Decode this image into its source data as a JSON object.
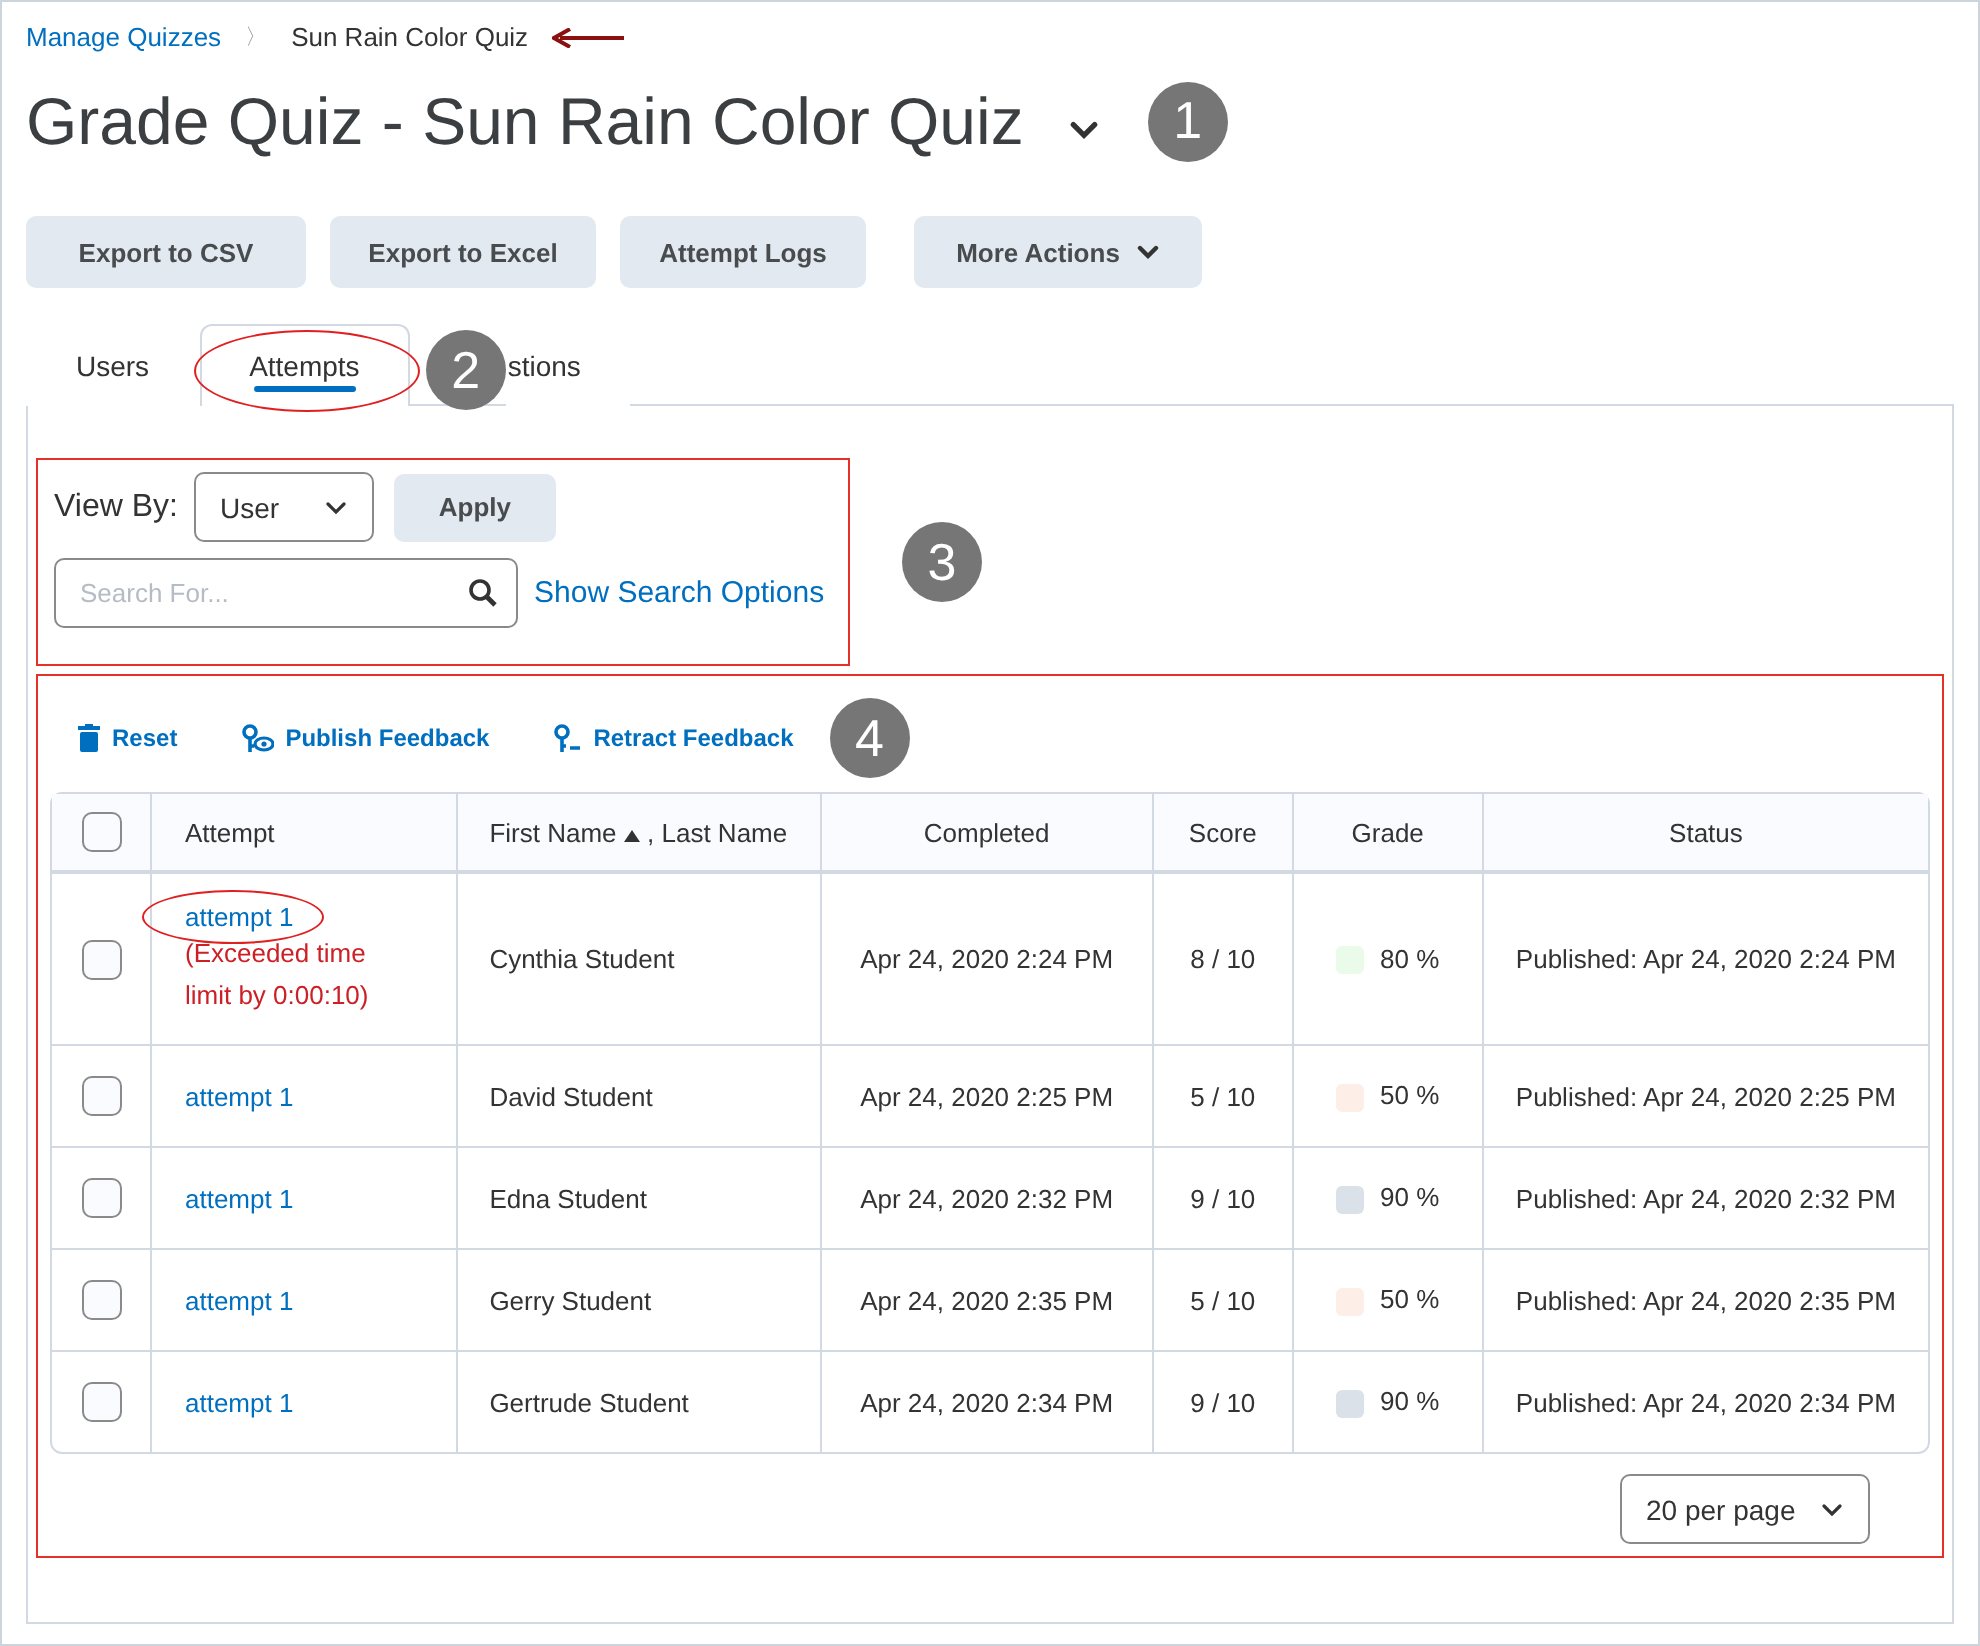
{
  "breadcrumb": {
    "link": "Manage Quizzes",
    "separator": "〉",
    "current": "Sun Rain Color Quiz",
    "arrow": true
  },
  "title": {
    "text": "Grade Quiz - Sun Rain Color Quiz",
    "callout": "1"
  },
  "actions": [
    {
      "label": "Export to CSV",
      "dropdown": false
    },
    {
      "label": "Export to Excel",
      "dropdown": false
    },
    {
      "label": "Attempt Logs",
      "dropdown": false
    },
    {
      "label": "More Actions",
      "dropdown": true
    }
  ],
  "tabs": [
    {
      "label": "Users",
      "selected": false,
      "circled": false
    },
    {
      "label": "Attempts",
      "selected": true,
      "circled": true
    },
    {
      "label": "stions",
      "selected": false,
      "circled": false
    }
  ],
  "tabs_callout": "2",
  "view_options": {
    "outlined": true,
    "callout": "3",
    "view_by_label": "View By:",
    "view_by_value": "User",
    "apply": "Apply",
    "search_placeholder": "Search For...",
    "search_options": "Show Search Options"
  },
  "results": {
    "outlined": true,
    "callout": "4",
    "toolbar": [
      {
        "kind": "trash",
        "label": "Reset"
      },
      {
        "kind": "publish",
        "label": "Publish Feedback"
      },
      {
        "kind": "retract",
        "label": "Retract Feedback"
      }
    ],
    "columns": [
      "Attempt",
      "First Name",
      ",",
      "Last Name",
      "Completed",
      "Score",
      "Grade",
      "Status"
    ],
    "header_checked": false,
    "rows": [
      {
        "checked": false,
        "attempt": "attempt 1",
        "circled": true,
        "note": "(Exceeded time limit by 0:00:10)",
        "name": "Cynthia Student",
        "completed": "Apr 24, 2020 2:24 PM",
        "score": "8 / 10",
        "grade": "80 %",
        "color": "#eafbea",
        "status": "Published: Apr 24, 2020 2:24 PM"
      },
      {
        "checked": false,
        "attempt": "attempt 1",
        "circled": false,
        "name": "David Student",
        "completed": "Apr 24, 2020 2:25 PM",
        "score": "5 / 10",
        "grade": "50 %",
        "color": "#fdeee8",
        "status": "Published: Apr 24, 2020 2:25 PM"
      },
      {
        "checked": false,
        "attempt": "attempt 1",
        "circled": false,
        "name": "Edna Student",
        "completed": "Apr 24, 2020 2:32 PM",
        "score": "9 / 10",
        "grade": "90 %",
        "color": "#dbe1e8",
        "status": "Published: Apr 24, 2020 2:32 PM"
      },
      {
        "checked": false,
        "attempt": "attempt 1",
        "circled": false,
        "name": "Gerry Student",
        "completed": "Apr 24, 2020 2:35 PM",
        "score": "5 / 10",
        "grade": "50 %",
        "color": "#fdeee8",
        "status": "Published: Apr 24, 2020 2:35 PM"
      },
      {
        "checked": false,
        "attempt": "attempt 1",
        "circled": false,
        "name": "Gertrude Student",
        "completed": "Apr 24, 2020 2:34 PM",
        "score": "9 / 10",
        "grade": "90 %",
        "color": "#dbe1e8",
        "status": "Published: Apr 24, 2020 2:34 PM"
      }
    ],
    "per_page": "20 per page"
  }
}
